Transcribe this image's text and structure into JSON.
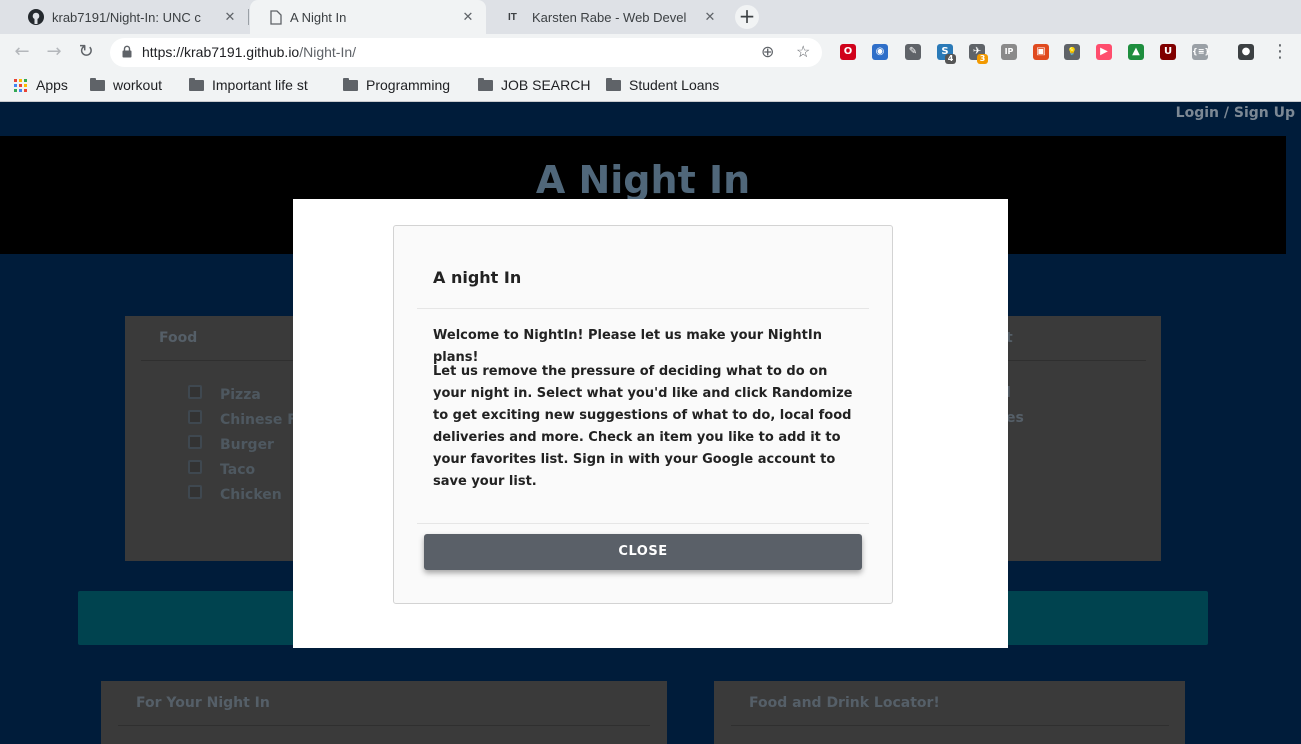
{
  "browser": {
    "tabs": [
      {
        "title": "krab7191/Night-In: UNC c",
        "icon": "github-icon",
        "active": false
      },
      {
        "title": "A Night In",
        "icon": "page-icon",
        "active": true
      },
      {
        "title": "Karsten Rabe - Web Devel",
        "icon": "it-icon",
        "active": false
      }
    ],
    "new_tab": "+",
    "tab_close": "✕",
    "it_glyph": "IT",
    "url_host": "https://krab7191.github.io",
    "url_path": "/Night-In/",
    "bookmarks": {
      "apps": "Apps",
      "items": [
        "workout",
        "Important life st",
        "Programming",
        "JOB SEARCH",
        "Student Loans"
      ]
    },
    "extensions": [
      {
        "name": "opera-icon",
        "glyph": "O",
        "color": "#d0021b"
      },
      {
        "name": "globe-icon",
        "glyph": "◉",
        "color": "#2f6fc9"
      },
      {
        "name": "eyedropper-icon",
        "glyph": "✎",
        "color": "#5f6368"
      },
      {
        "name": "s-extension-icon",
        "glyph": "S",
        "color": "#2a7ab8",
        "badge": "4"
      },
      {
        "name": "plane-extension-icon",
        "glyph": "✈",
        "color": "#5f6368",
        "badge": "3"
      },
      {
        "name": "ip-icon",
        "glyph": "IP",
        "color": "#8a8a8a"
      },
      {
        "name": "lastpass-like-icon",
        "glyph": "▣",
        "color": "#e04a1f"
      },
      {
        "name": "lightbulb-icon",
        "glyph": "💡",
        "color": "#5f6368"
      },
      {
        "name": "play-icon",
        "glyph": "▶",
        "color": "#ff4d6d"
      },
      {
        "name": "chevron-up-icon",
        "glyph": "▲",
        "color": "#1e8e3e"
      },
      {
        "name": "ublock-icon",
        "glyph": "U",
        "color": "#800000"
      },
      {
        "name": "json-icon",
        "glyph": "{≡}",
        "color": "#9aa0a6"
      },
      {
        "name": "profile-icon",
        "glyph": "●",
        "color": "#3c4043"
      }
    ]
  },
  "page": {
    "login": "Login / Sign Up",
    "title": "A Night In",
    "food_card": {
      "title": "Food",
      "items": [
        "Pizza",
        "Chinese Fo",
        "Burger",
        "Taco",
        "Chicken"
      ]
    },
    "right_card": {
      "title_fragment": "t",
      "items": [
        "l",
        "es"
      ]
    },
    "for_your_night": "For Your Night In",
    "food_locator": "Food and Drink Locator!"
  },
  "modal": {
    "title": "A night In",
    "welcome": "Welcome to NightIn! Please let us make your NightIn plans!",
    "body": "Let us remove the pressure of deciding what to do on your night in. Select what you'd like and click Randomize to get exciting new suggestions of what to do, local food deliveries and more. Check an item you like to add it to your favorites list. Sign in with your Google account to save your list.",
    "close_label": "CLOSE"
  }
}
